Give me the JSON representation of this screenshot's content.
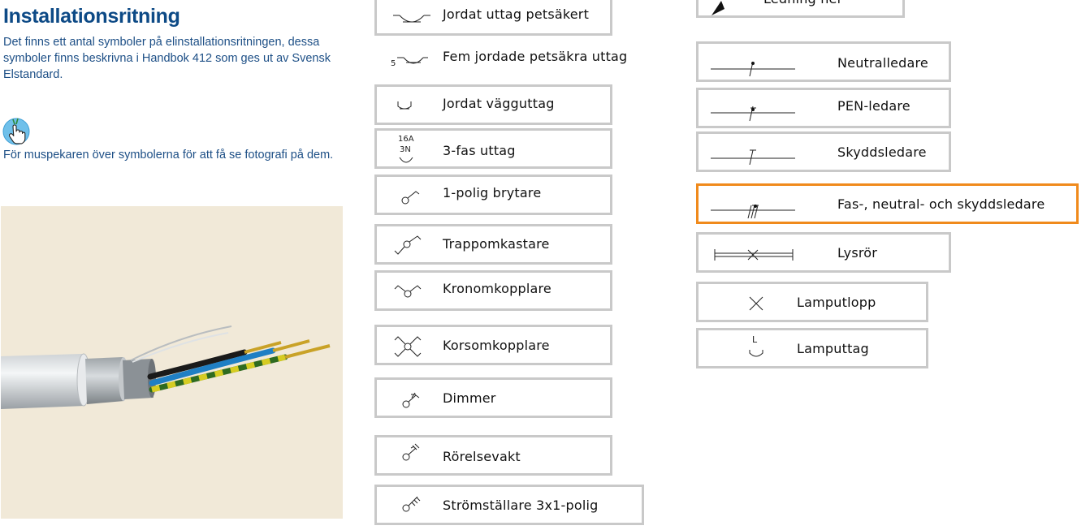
{
  "page": {
    "title": "Installationsritning",
    "intro": "Det finns ett antal symboler på elinstallationsritningen, dessa symboler finns beskrivna i Handbok 412 som ges ut av Svensk Elstandard.",
    "hint_icon": "pointer-hand-icon",
    "hint": "För muspekaren över symbolerna för att få se fotografi på dem."
  },
  "photo": {
    "subject": "cable-photo"
  },
  "symbols_left": [
    {
      "label": "Jordat uttag petsäkert",
      "icon": "grounded-outlet-childsafe-icon"
    },
    {
      "label": "Fem jordade petsäkra uttag",
      "icon": "five-grounded-outlets-icon",
      "count": "5"
    },
    {
      "label": "Jordat vägguttag",
      "icon": "grounded-wall-outlet-icon"
    },
    {
      "label": "3-fas uttag",
      "icon": "three-phase-outlet-icon",
      "rating": "16A",
      "phase": "3N"
    },
    {
      "label": "1-polig brytare",
      "icon": "single-pole-switch-icon"
    },
    {
      "label": "Trappomkastare",
      "icon": "staircase-switch-icon"
    },
    {
      "label": "Kronomkopplare",
      "icon": "chandelier-switch-icon"
    },
    {
      "label": "Korsomkopplare",
      "icon": "cross-switch-icon"
    },
    {
      "label": "Dimmer",
      "icon": "dimmer-icon"
    },
    {
      "label": "Rörelsevakt",
      "icon": "motion-detector-icon"
    },
    {
      "label": "Strömställare 3x1-polig",
      "icon": "switch-3x1-pole-icon"
    }
  ],
  "symbols_right": [
    {
      "label": "Ledning ner",
      "icon": "wire-down-icon"
    },
    {
      "label": "Neutralledare",
      "icon": "neutral-conductor-icon"
    },
    {
      "label": "PEN-ledare",
      "icon": "pen-conductor-icon"
    },
    {
      "label": "Skyddsledare",
      "icon": "protective-conductor-icon"
    },
    {
      "label": "Fas-, neutral- och skyddsledare",
      "icon": "phase-neutral-protective-icon",
      "selected": true
    },
    {
      "label": "Lysrör",
      "icon": "fluorescent-tube-icon"
    },
    {
      "label": "Lamputlopp",
      "icon": "lamp-outlet-icon"
    },
    {
      "label": "Lamputtag",
      "icon": "lamp-socket-icon",
      "letter": "L"
    }
  ],
  "colors": {
    "title": "#0d4a86",
    "text": "#1d4f86",
    "border": "#c9c9c9",
    "selected_border": "#f08a1c",
    "photo_bg": "#f1e9d8"
  }
}
